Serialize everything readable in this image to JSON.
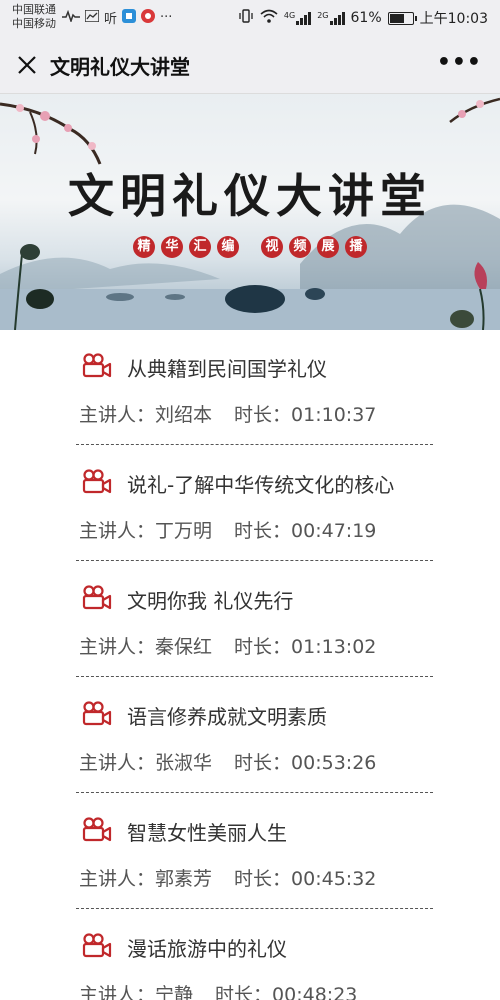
{
  "status": {
    "carrier1": "中国联通",
    "carrier2": "中国移动",
    "left_extra": "听",
    "battery_percent": "61%",
    "time": "上午10:03",
    "signal1_tag": "4G",
    "signal2_tag": "2G"
  },
  "nav": {
    "title": "文明礼仪大讲堂",
    "more": "•••"
  },
  "banner": {
    "title": "文明礼仪大讲堂",
    "tags_left": [
      "精",
      "华",
      "汇",
      "编"
    ],
    "tags_right": [
      "视",
      "频",
      "展",
      "播"
    ]
  },
  "list": {
    "speaker_label": "主讲人：",
    "duration_label": "时长：",
    "items": [
      {
        "title": "从典籍到民间国学礼仪",
        "speaker": "刘绍本",
        "duration": "01:10:37"
      },
      {
        "title": "说礼-了解中华传统文化的核心",
        "speaker": "丁万明",
        "duration": "00:47:19"
      },
      {
        "title": "文明你我 礼仪先行",
        "speaker": "秦保红",
        "duration": "01:13:02"
      },
      {
        "title": "语言修养成就文明素质",
        "speaker": "张淑华",
        "duration": "00:53:26"
      },
      {
        "title": "智慧女性美丽人生",
        "speaker": "郭素芳",
        "duration": "00:45:32"
      },
      {
        "title": "漫话旅游中的礼仪",
        "speaker": "宁静",
        "duration": "00:48:23"
      }
    ]
  },
  "colors": {
    "accent_red": "#c0282b",
    "bar_bg": "#efeff2"
  }
}
